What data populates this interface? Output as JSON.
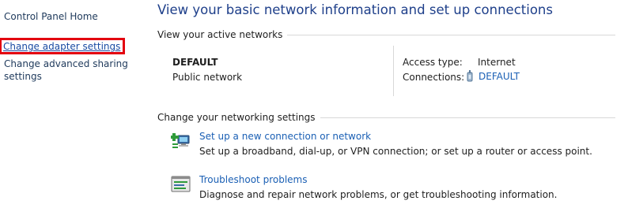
{
  "sidebar": {
    "home_label": "Control Panel Home",
    "adapter_label": "Change adapter settings",
    "sharing_label": "Change advanced sharing settings"
  },
  "main": {
    "title": "View your basic network information and set up connections",
    "active_networks": {
      "header": "View your active networks",
      "network_name": "DEFAULT",
      "network_type": "Public network",
      "access_type_label": "Access type:",
      "access_type_value": "Internet",
      "connections_label": "Connections:",
      "connections_value": "DEFAULT",
      "connections_icon": "wireless-adapter-icon"
    },
    "networking_settings": {
      "header": "Change your networking settings",
      "tasks": [
        {
          "icon": "new-connection-icon",
          "link": "Set up a new connection or network",
          "description": "Set up a broadband, dial-up, or VPN connection; or set up a router or access point."
        },
        {
          "icon": "troubleshoot-icon",
          "link": "Troubleshoot problems",
          "description": "Diagnose and repair network problems, or get troubleshooting information."
        }
      ]
    }
  },
  "colors": {
    "link": "#1a5fb4",
    "title": "#1e3f8a",
    "highlight_box": "#e3000f"
  }
}
